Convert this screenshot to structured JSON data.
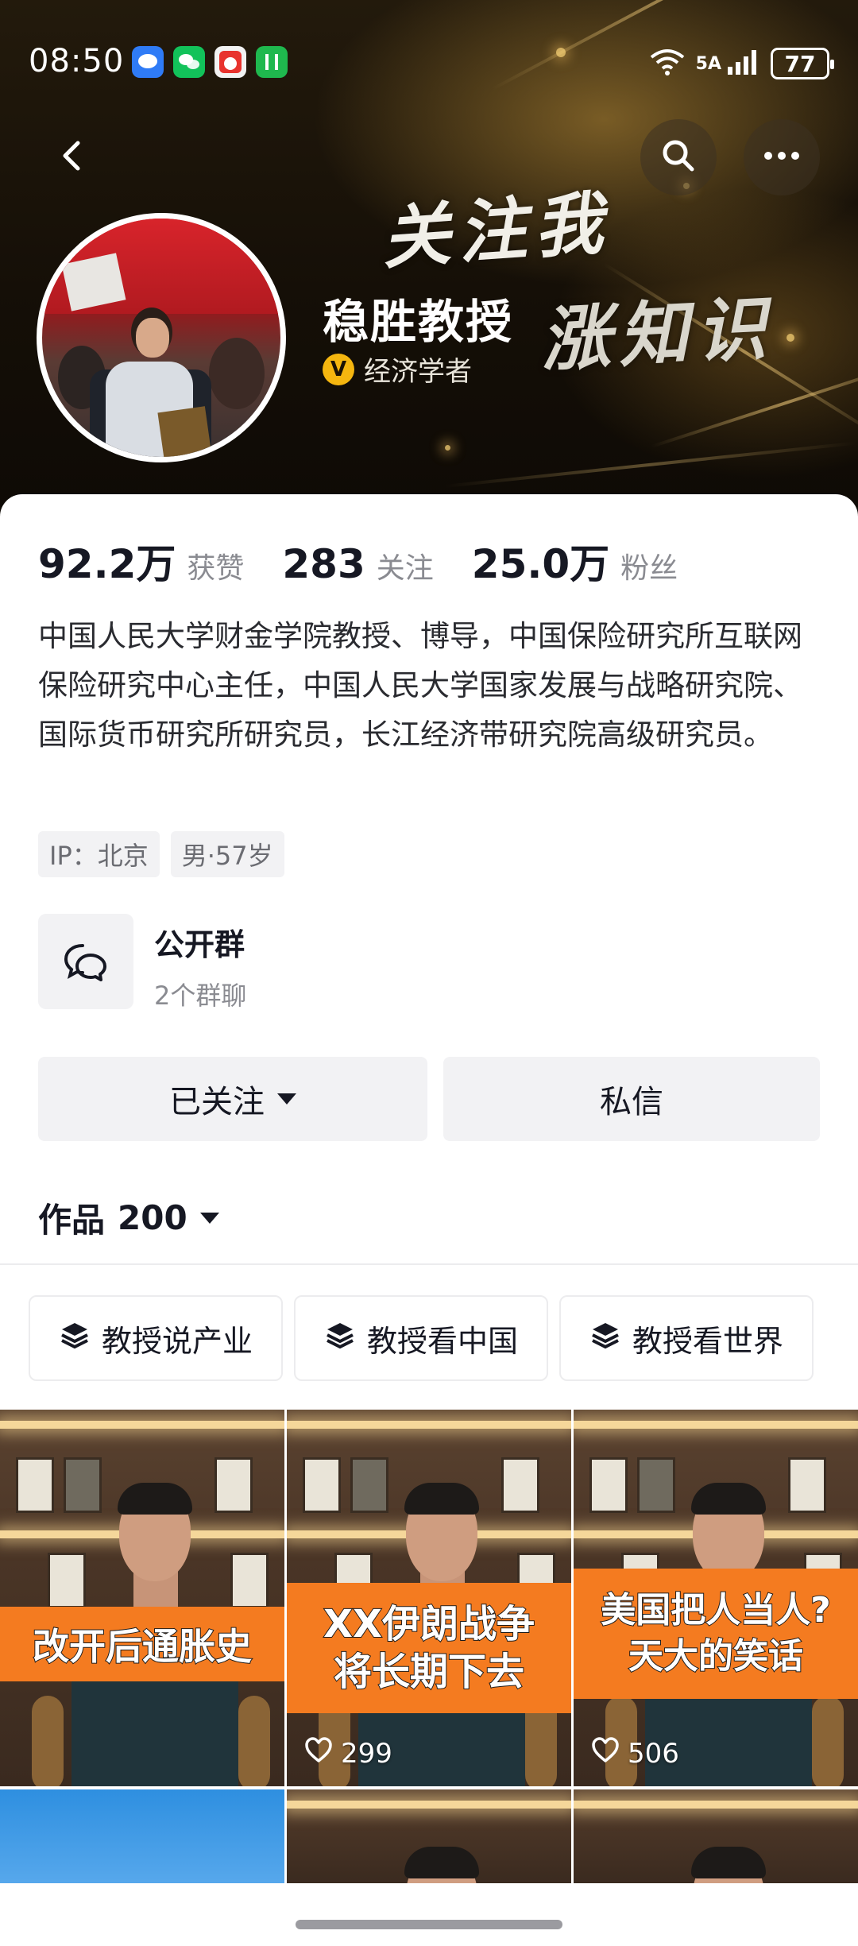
{
  "status_bar": {
    "time": "08:50",
    "network": "5A",
    "battery": "77"
  },
  "header": {
    "banner_line1": "关注我",
    "banner_line2": "涨知识",
    "name": "稳胜教授",
    "verify_badge": "V",
    "verify_text": "经济学者"
  },
  "stats": [
    {
      "num": "92.2万",
      "label": "获赞"
    },
    {
      "num": "283",
      "label": "关注"
    },
    {
      "num": "25.0万",
      "label": "粉丝"
    }
  ],
  "bio": "中国人民大学财金学院教授、博导，中国保险研究所互联网保险研究中心主任，中国人民大学国家发展与战略研究院、国际货币研究所研究员，长江经济带研究院高级研究员。",
  "tags": [
    "IP：北京",
    "男·57岁"
  ],
  "group": {
    "title": "公开群",
    "subtitle": "2个群聊"
  },
  "actions": {
    "follow": "已关注",
    "message": "私信"
  },
  "works": {
    "label": "作品",
    "count": "200"
  },
  "collections": [
    "教授说产业",
    "教授看中国",
    "教授看世界"
  ],
  "videos": [
    {
      "caption_lines": [
        "改开后通胀史"
      ],
      "likes": ""
    },
    {
      "caption_lines": [
        "XX伊朗战争",
        "将长期下去"
      ],
      "likes": "299"
    },
    {
      "caption_lines": [
        "美国把人当人?",
        "天大的笑话"
      ],
      "likes": "506"
    }
  ],
  "colors": {
    "accent_orange": "#f47b20",
    "verify_gold": "#f5b60f",
    "text_primary": "#161823",
    "text_secondary": "#8a8b91"
  }
}
